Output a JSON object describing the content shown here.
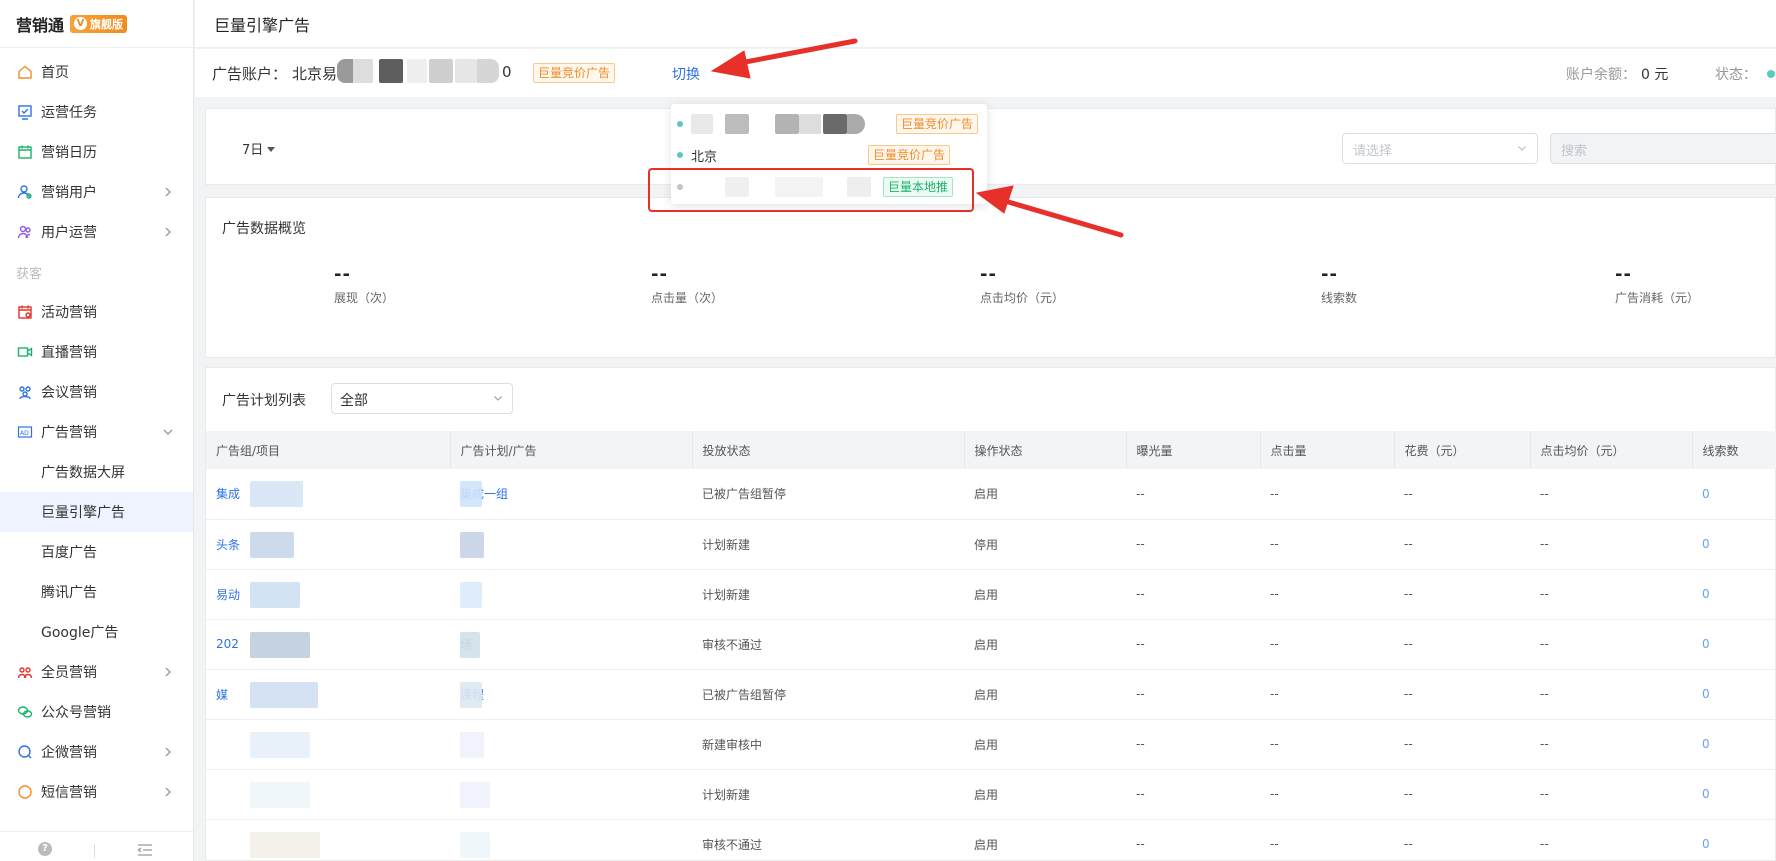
{
  "brand": {
    "name": "营销通",
    "badge": "旗舰版"
  },
  "sidebar": {
    "items": [
      {
        "label": "首页",
        "icon": "home-icon"
      },
      {
        "label": "运营任务",
        "icon": "task-icon"
      },
      {
        "label": "营销日历",
        "icon": "calendar-icon"
      },
      {
        "label": "营销用户",
        "icon": "user-icon"
      },
      {
        "label": "用户运营",
        "icon": "user-group-icon"
      }
    ],
    "section": "获客",
    "items2": [
      {
        "label": "活动营销",
        "icon": "event-icon"
      },
      {
        "label": "直播营销",
        "icon": "video-icon"
      },
      {
        "label": "会议营销",
        "icon": "meeting-icon"
      },
      {
        "label": "广告营销",
        "icon": "ad-icon"
      }
    ],
    "sub_items": [
      "广告数据大屏",
      "巨量引擎广告",
      "百度广告",
      "腾讯广告",
      "Google广告"
    ],
    "items3": [
      {
        "label": "全员营销",
        "icon": "staff-icon"
      },
      {
        "label": "公众号营销",
        "icon": "wechat-icon"
      },
      {
        "label": "企微营销",
        "icon": "wecom-icon"
      },
      {
        "label": "短信营销",
        "icon": "sms-icon"
      }
    ],
    "help": "?"
  },
  "page_title": "巨量引擎广告",
  "account": {
    "label": "广告账户：",
    "name": "北京易",
    "suffix": "0",
    "tag": "巨量竞价广告",
    "switch_label": "切换",
    "balance_label": "账户余额：",
    "balance_value": "0 元",
    "status_label": "状态："
  },
  "dropdown": {
    "items": [
      {
        "text": "",
        "tag": "巨量竞价广告",
        "tag_type": "orange",
        "dot": "#5cc9c0"
      },
      {
        "text": "北京",
        "tag": "巨量竞价广告",
        "tag_type": "orange",
        "dot": "#5cc9c0"
      },
      {
        "text": "",
        "tag": "巨量本地推",
        "tag_type": "green",
        "dot": "#c0c4cc"
      }
    ]
  },
  "filter": {
    "range": "7日",
    "select_placeholder": "请选择",
    "search_placeholder": "搜索"
  },
  "overview": {
    "title": "广告数据概览",
    "metrics": [
      {
        "value": "--",
        "label": "展现（次）"
      },
      {
        "value": "--",
        "label": "点击量（次）"
      },
      {
        "value": "--",
        "label": "点击均价（元）"
      },
      {
        "value": "--",
        "label": "线索数"
      },
      {
        "value": "--",
        "label": "广告消耗（元）"
      }
    ]
  },
  "table": {
    "title": "广告计划列表",
    "filter_value": "全部",
    "columns": [
      "广告组/项目",
      "广告计划/广告",
      "投放状态",
      "操作状态",
      "曝光量",
      "点击量",
      "花费（元）",
      "点击均价（元）",
      "线索数"
    ],
    "rows": [
      {
        "group": "集成",
        "plan": "集成一组",
        "delivery": "已被广告组暂停",
        "op": "启用",
        "imp": "--",
        "clk": "--",
        "cost": "--",
        "cpc": "--",
        "leads": "0"
      },
      {
        "group": "头条",
        "plan": "",
        "delivery": "计划新建",
        "op": "停用",
        "imp": "--",
        "clk": "--",
        "cost": "--",
        "cpc": "--",
        "leads": "0"
      },
      {
        "group": "易动",
        "plan": "",
        "delivery": "计划新建",
        "op": "启用",
        "imp": "--",
        "clk": "--",
        "cost": "--",
        "cpc": "--",
        "leads": "0"
      },
      {
        "group": "202",
        "plan": "场",
        "delivery": "审核不通过",
        "op": "启用",
        "imp": "--",
        "clk": "--",
        "cost": "--",
        "cpc": "--",
        "leads": "0"
      },
      {
        "group": "媒",
        "plan": "课程",
        "delivery": "已被广告组暂停",
        "op": "启用",
        "imp": "--",
        "clk": "--",
        "cost": "--",
        "cpc": "--",
        "leads": "0"
      },
      {
        "group": "",
        "plan": "",
        "delivery": "新建审核中",
        "op": "启用",
        "imp": "--",
        "clk": "--",
        "cost": "--",
        "cpc": "--",
        "leads": "0"
      },
      {
        "group": "",
        "plan": "",
        "delivery": "计划新建",
        "op": "启用",
        "imp": "--",
        "clk": "--",
        "cost": "--",
        "cpc": "--",
        "leads": "0"
      },
      {
        "group": "",
        "plan": "",
        "delivery": "审核不通过",
        "op": "启用",
        "imp": "--",
        "clk": "--",
        "cost": "--",
        "cpc": "--",
        "leads": "0"
      }
    ]
  },
  "colors": {
    "accent": "#2f72e4",
    "annotation": "#e8302a",
    "tag_orange": "#f08c2b",
    "tag_green": "#19b46a"
  }
}
